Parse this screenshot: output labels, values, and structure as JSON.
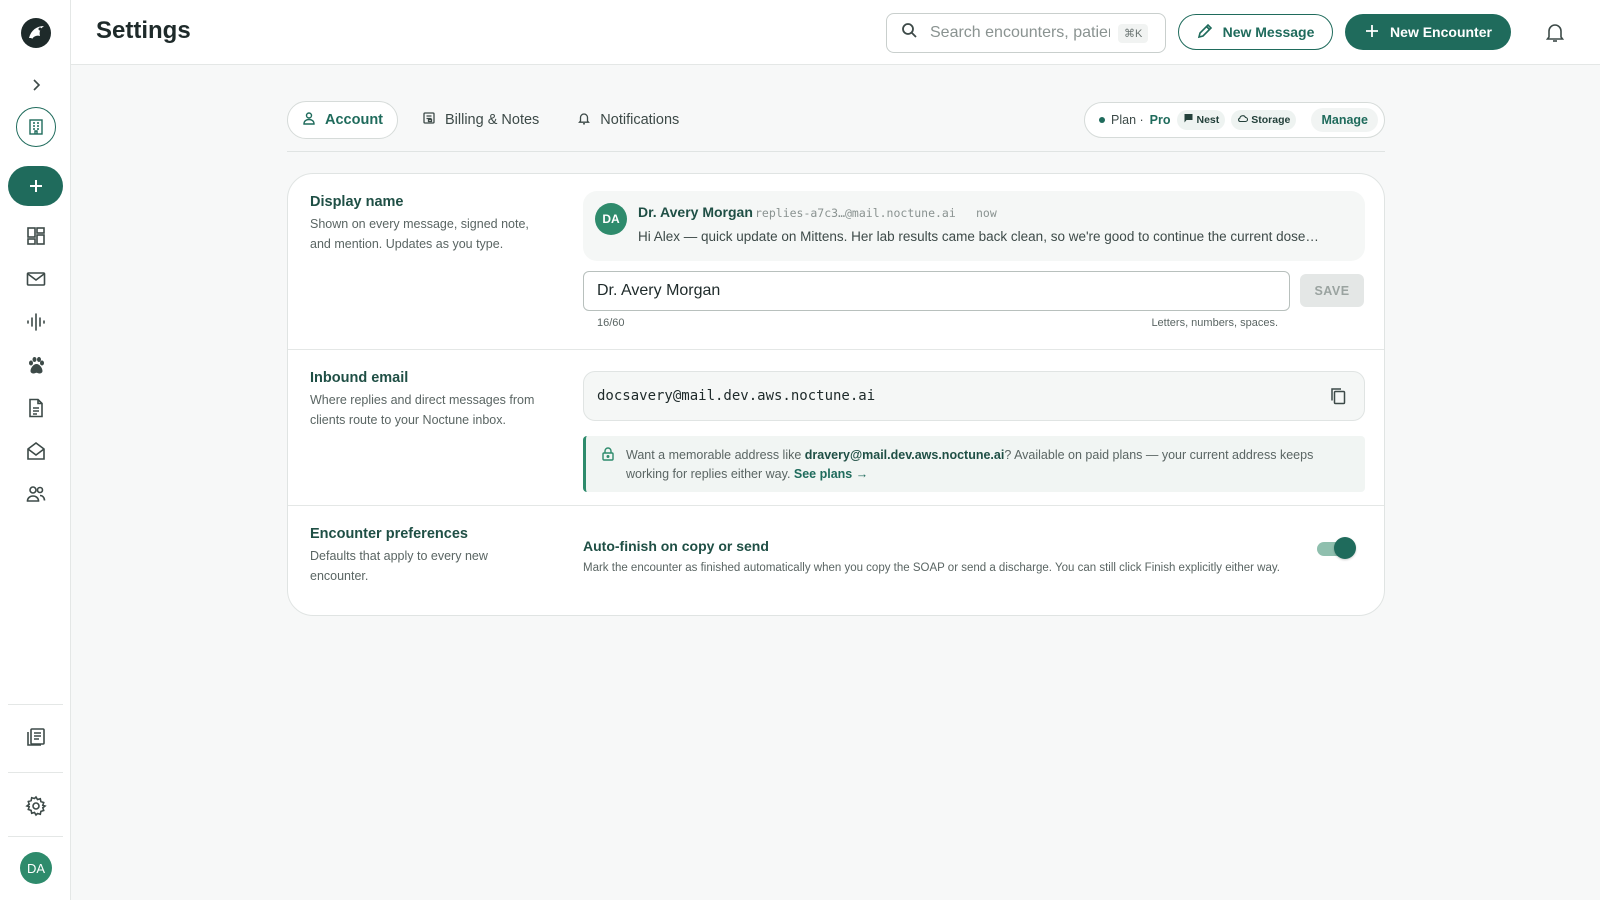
{
  "header": {
    "title": "Settings",
    "search_placeholder": "Search encounters, patients…",
    "search_shortcut": "⌘K",
    "new_message_label": "New Message",
    "new_encounter_label": "New Encounter"
  },
  "sidebar": {
    "avatar_initials": "DA",
    "items": [
      {
        "name": "dashboard-icon"
      },
      {
        "name": "mail-icon"
      },
      {
        "name": "waveform-icon"
      },
      {
        "name": "paw-icon"
      },
      {
        "name": "document-icon"
      },
      {
        "name": "open-mail-icon"
      },
      {
        "name": "people-icon"
      },
      {
        "name": "notes-icon"
      },
      {
        "name": "gear-icon"
      }
    ]
  },
  "tabs": [
    {
      "label": "Account",
      "icon": "person-icon",
      "active": true
    },
    {
      "label": "Billing & Notes",
      "icon": "receipt-icon",
      "active": false
    },
    {
      "label": "Notifications",
      "icon": "bell-icon",
      "active": false
    }
  ],
  "plan": {
    "label": "Plan ·",
    "tier": "Pro",
    "chip_nest": "Nest",
    "chip_storage": "Storage",
    "manage_label": "Manage"
  },
  "display_name": {
    "title": "Display name",
    "desc": "Shown on every message, signed note, and mention. Updates as you type.",
    "preview_initials": "DA",
    "preview_name": "Dr. Avery Morgan",
    "preview_address": "replies-a7c3…@mail.noctune.ai",
    "preview_time": "now",
    "preview_message": "Hi Alex — quick update on Mittens. Her lab results came back clean, so we're good to continue the current dose…",
    "input_value": "Dr. Avery Morgan",
    "save_label": "SAVE",
    "counter": "16/60",
    "hint": "Letters, numbers, spaces."
  },
  "inbound_email": {
    "title": "Inbound email",
    "desc": "Where replies and direct messages from clients route to your Noctune inbox.",
    "address": "docsavery@mail.dev.aws.noctune.ai",
    "callout_prefix": "Want a memorable address like ",
    "callout_example": "dravery@mail.dev.aws.noctune.ai",
    "callout_suffix": "? Available on paid plans — your current address keeps working for replies either way. ",
    "callout_link": "See plans →"
  },
  "encounter_prefs": {
    "title": "Encounter preferences",
    "desc": "Defaults that apply to every new encounter.",
    "auto_finish_title": "Auto-finish on copy or send",
    "auto_finish_desc": "Mark the encounter as finished automatically when you copy the SOAP or send a discharge. You can still click Finish explicitly either way.",
    "auto_finish_enabled": true
  },
  "colors": {
    "accent": "#1f6b5c",
    "avatar": "#2e8b6c"
  }
}
